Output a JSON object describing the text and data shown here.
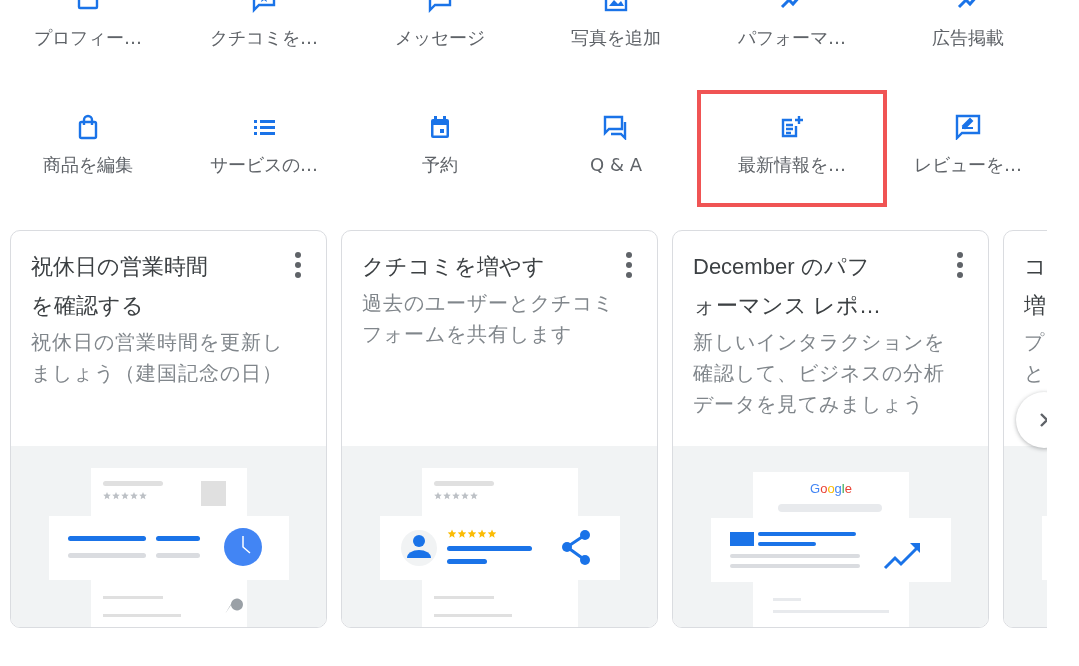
{
  "actions": [
    {
      "label": "プロフィー…",
      "highlighted": false
    },
    {
      "label": "クチコミを…",
      "highlighted": false
    },
    {
      "label": "メッセージ",
      "highlighted": false
    },
    {
      "label": "写真を追加",
      "highlighted": false
    },
    {
      "label": "パフォーマ…",
      "highlighted": false
    },
    {
      "label": "広告掲載",
      "highlighted": false
    },
    {
      "label": "商品を編集",
      "highlighted": false
    },
    {
      "label": "サービスの…",
      "highlighted": false
    },
    {
      "label": "予約",
      "highlighted": false
    },
    {
      "label": "Q & A",
      "highlighted": false
    },
    {
      "label": "最新情報を…",
      "highlighted": true
    },
    {
      "label": "レビューを…",
      "highlighted": false
    }
  ],
  "cards": [
    {
      "kind": "full",
      "title": "祝休日の営業時間を確認する",
      "description": "祝休日の営業時間を更新しましょう（建国記念の日）"
    },
    {
      "kind": "full",
      "title": "クチコミを増やす",
      "description": "過去のユーザーとクチコミフォームを共有します"
    },
    {
      "kind": "full",
      "title": "December のパフォーマンス レポ…",
      "description": "新しいインタラクションを確認して、ビジネスの分析データを見てみましょう",
      "logo": "Google"
    },
    {
      "kind": "cut",
      "title": "コ増",
      "description": "プと"
    }
  ]
}
